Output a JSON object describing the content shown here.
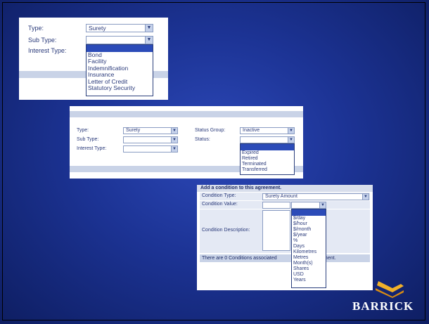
{
  "panel1": {
    "type_label": "Type:",
    "type_value": "Surety",
    "subtype_label": "Sub Type:",
    "interest_label": "Interest Type:",
    "options": [
      "Bond",
      "Facility",
      "Indemnification",
      "Insurance",
      "Letter of Credit",
      "Statutory Security"
    ]
  },
  "panel2": {
    "type_label": "Type:",
    "type_value": "Surety",
    "subtype_label": "Sub Type:",
    "interest_label": "Interest Type:",
    "status_group_label": "Status Group:",
    "status_group_value": "Inactive",
    "status_label": "Status:",
    "options": [
      "Expired",
      "Retired",
      "Terminated",
      "Transferred"
    ]
  },
  "panel3": {
    "header": "Add a condition to this agreement.",
    "condition_type_label": "Condition Type:",
    "condition_type_value": "Surety Amount",
    "condition_value_label": "Condition Value:",
    "condition_description_label": "Condition Description:",
    "footer_left": "There are 0 Conditions associated",
    "footer_right": "ment.",
    "units": [
      "$/day",
      "$/hour",
      "$/month",
      "$/year",
      "%",
      "Days",
      "Kilometres",
      "Metres",
      "Month(s)",
      "Shares",
      "USD",
      "Years"
    ]
  },
  "logo": {
    "text": "BARRICK",
    "icon": "barrick-logo-icon"
  },
  "colors": {
    "slide_bg": "#1c3394",
    "highlight": "#2b4bb8",
    "band": "#c9d3e7",
    "logo_gold": "#e8a31c"
  }
}
